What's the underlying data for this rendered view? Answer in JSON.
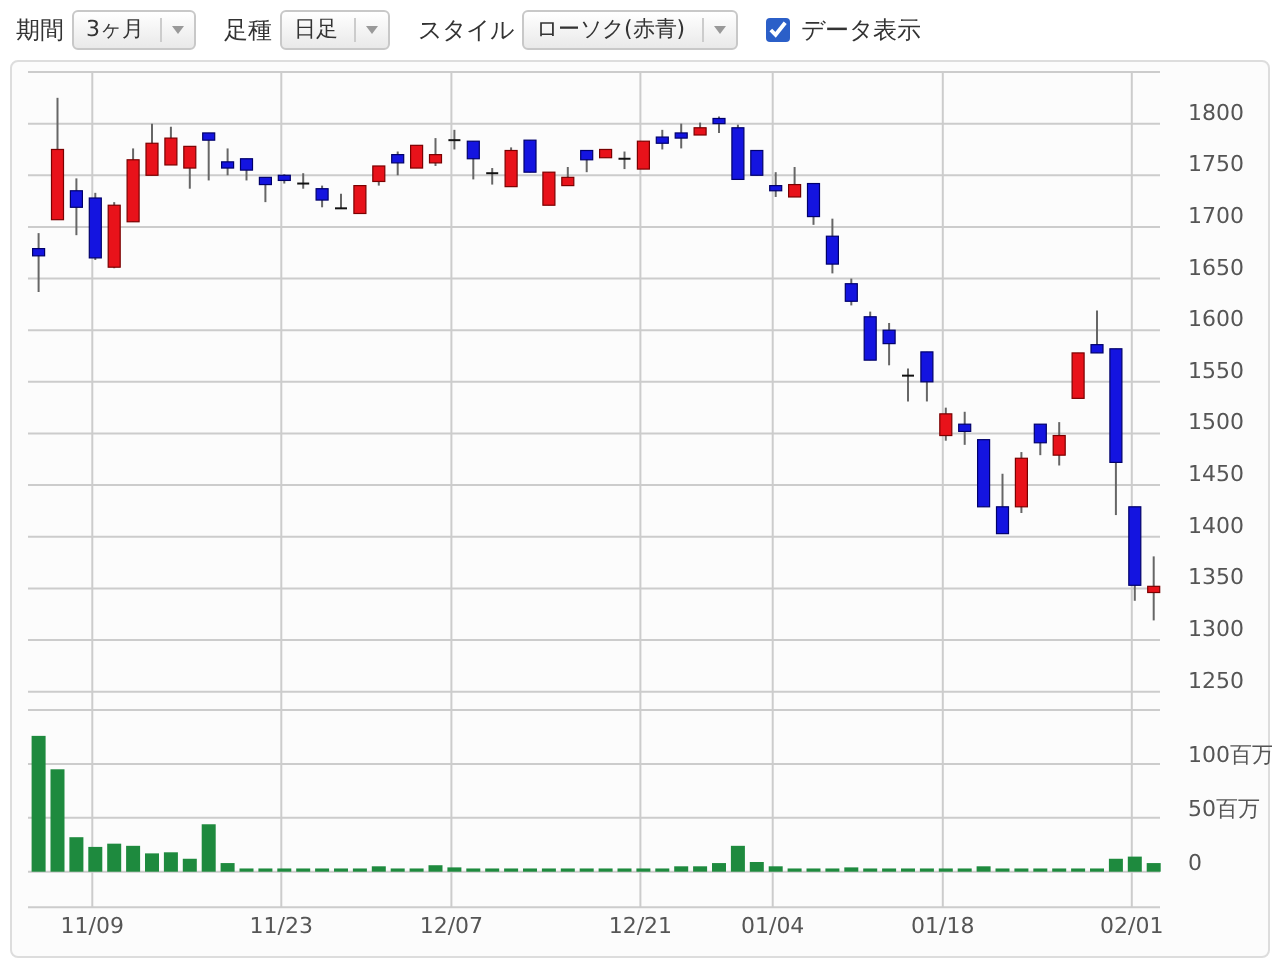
{
  "toolbar": {
    "controls": [
      {
        "kind": "dropdown",
        "label": "期間",
        "value": "3ヶ月"
      },
      {
        "kind": "dropdown",
        "label": "足種",
        "value": "日足"
      },
      {
        "kind": "dropdown",
        "label": "スタイル",
        "value": "ローソク(赤青)"
      },
      {
        "kind": "checkbox",
        "label": "データ表示",
        "checked": true
      }
    ]
  },
  "price_chart": {
    "chart_data": {
      "type": "candlestick",
      "grid": true,
      "ylim": [
        1240,
        1850
      ],
      "yticks": [
        1250,
        1300,
        1350,
        1400,
        1450,
        1500,
        1550,
        1600,
        1650,
        1700,
        1750,
        1800
      ],
      "categories": [
        null,
        null,
        null,
        null,
        null,
        null,
        null,
        null,
        null,
        null,
        null,
        null,
        null,
        null,
        null,
        null,
        null,
        null,
        null,
        null,
        null,
        null,
        null,
        null,
        null,
        null,
        null,
        null,
        null,
        null,
        null,
        null,
        null,
        null,
        null,
        null,
        null,
        null,
        null,
        null,
        null,
        null,
        null,
        null,
        null,
        null,
        null,
        null,
        null,
        null,
        null,
        null,
        null,
        null,
        null,
        null,
        null,
        null,
        null,
        null
      ],
      "ohlc": [
        [
          1679,
          1694,
          1637,
          1672
        ],
        [
          1707,
          1825,
          1707,
          1775
        ],
        [
          1735,
          1747,
          1692,
          1719
        ],
        [
          1728,
          1733,
          1668,
          1670
        ],
        [
          1661,
          1724,
          1660,
          1721
        ],
        [
          1705,
          1776,
          1705,
          1765
        ],
        [
          1750,
          1800,
          1750,
          1781
        ],
        [
          1760,
          1797,
          1760,
          1786
        ],
        [
          1757,
          1778,
          1737,
          1778
        ],
        [
          1791,
          1791,
          1745,
          1784
        ],
        [
          1763,
          1776,
          1750,
          1757
        ],
        [
          1766,
          1766,
          1745,
          1755
        ],
        [
          1748,
          1748,
          1724,
          1741
        ],
        [
          1750,
          1751,
          1742,
          1745
        ],
        [
          1742,
          1752,
          1737,
          1742
        ],
        [
          1737,
          1740,
          1719,
          1726
        ],
        [
          1718,
          1732,
          1718,
          1718
        ],
        [
          1713,
          1740,
          1713,
          1740
        ],
        [
          1744,
          1759,
          1740,
          1759
        ],
        [
          1770,
          1773,
          1750,
          1762
        ],
        [
          1757,
          1779,
          1757,
          1779
        ],
        [
          1762,
          1786,
          1759,
          1770
        ],
        [
          1784,
          1794,
          1775,
          1784
        ],
        [
          1783,
          1783,
          1746,
          1766
        ],
        [
          1752,
          1757,
          1741,
          1752
        ],
        [
          1739,
          1777,
          1739,
          1774
        ],
        [
          1784,
          1784,
          1753,
          1753
        ],
        [
          1721,
          1753,
          1721,
          1753
        ],
        [
          1740,
          1758,
          1740,
          1748
        ],
        [
          1774,
          1774,
          1753,
          1765
        ],
        [
          1767,
          1775,
          1767,
          1775
        ],
        [
          1766,
          1773,
          1756,
          1766
        ],
        [
          1756,
          1783,
          1756,
          1783
        ],
        [
          1787,
          1794,
          1775,
          1781
        ],
        [
          1791,
          1800,
          1776,
          1786
        ],
        [
          1789,
          1801,
          1789,
          1796
        ],
        [
          1805,
          1807,
          1791,
          1800
        ],
        [
          1796,
          1799,
          1746,
          1746
        ],
        [
          1774,
          1774,
          1750,
          1750
        ],
        [
          1740,
          1753,
          1729,
          1735
        ],
        [
          1729,
          1758,
          1729,
          1741
        ],
        [
          1742,
          1742,
          1702,
          1710
        ],
        [
          1691,
          1708,
          1655,
          1664
        ],
        [
          1645,
          1650,
          1624,
          1628
        ],
        [
          1613,
          1618,
          1571,
          1571
        ],
        [
          1600,
          1607,
          1566,
          1587
        ],
        [
          1556,
          1563,
          1531,
          1556
        ],
        [
          1579,
          1579,
          1531,
          1550
        ],
        [
          1498,
          1525,
          1493,
          1519
        ],
        [
          1509,
          1521,
          1489,
          1502
        ],
        [
          1494,
          1494,
          1429,
          1429
        ],
        [
          1429,
          1461,
          1403,
          1403
        ],
        [
          1429,
          1482,
          1423,
          1476
        ],
        [
          1509,
          1509,
          1479,
          1491
        ],
        [
          1479,
          1511,
          1469,
          1498
        ],
        [
          1534,
          1578,
          1534,
          1578
        ],
        [
          1586,
          1619,
          1578,
          1578
        ],
        [
          1582,
          1582,
          1421,
          1472
        ],
        [
          1429,
          1429,
          1338,
          1353
        ],
        [
          1346,
          1381,
          1319,
          1352
        ]
      ]
    }
  },
  "volume_chart": {
    "chart_data": {
      "type": "bar",
      "grid": true,
      "ylim": [
        -33,
        150
      ],
      "categories": [
        null,
        null,
        null,
        "11/09",
        null,
        null,
        null,
        null,
        null,
        null,
        null,
        null,
        null,
        "11/23",
        null,
        null,
        null,
        null,
        null,
        null,
        null,
        null,
        "12/07",
        null,
        null,
        null,
        null,
        null,
        null,
        null,
        null,
        null,
        "12/21",
        null,
        null,
        null,
        null,
        null,
        null,
        "01/04",
        null,
        null,
        null,
        null,
        null,
        null,
        null,
        null,
        "01/18",
        null,
        null,
        null,
        null,
        null,
        null,
        null,
        null,
        null,
        "02/01",
        null
      ],
      "yticks": [
        {
          "value": 0,
          "label": "0"
        },
        {
          "value": 50,
          "label": "50百万"
        },
        {
          "value": 100,
          "label": "100百万"
        }
      ],
      "series": [
        {
          "color": "#1e8a3e",
          "values": [
            126,
            95,
            32,
            23,
            26,
            24,
            17,
            18,
            12,
            44,
            8,
            3,
            3,
            3,
            3,
            3,
            3,
            3,
            5,
            3,
            3,
            6,
            4,
            3,
            3,
            3,
            3,
            3,
            3,
            3,
            3,
            3,
            3,
            3,
            5,
            5,
            8,
            24,
            9,
            5,
            3,
            3,
            3,
            4,
            3,
            3,
            3,
            3,
            3,
            3,
            5,
            3,
            3,
            3,
            3,
            3,
            3,
            12,
            14,
            8
          ]
        }
      ]
    }
  }
}
